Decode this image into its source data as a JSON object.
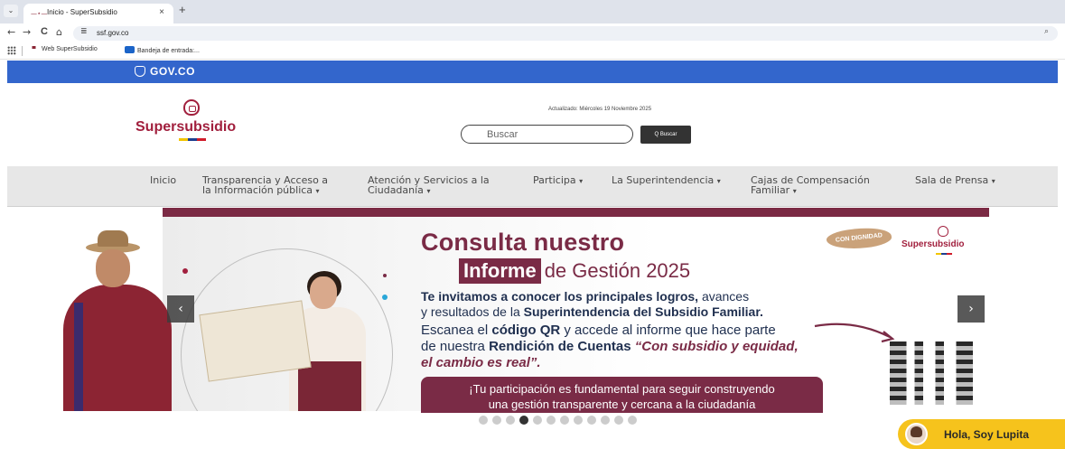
{
  "browser": {
    "tab_title": "Inicio - SuperSubsidio",
    "favicon": "—⋆—",
    "tab_close": "×",
    "new_tab": "+",
    "tab_menu": "⌄",
    "back": "←",
    "forward": "→",
    "reload": "C",
    "home": "⌂",
    "site_info": "≣",
    "url": "ssf.gov.co",
    "zoom": "⌕",
    "bookmarks": [
      "Web SuperSubsidio",
      "Bandeja de entrada:..."
    ]
  },
  "govbar": {
    "logo": "GOV.CO"
  },
  "header": {
    "brand": "Supersubsidio",
    "updated": "Actualizado: Miércoles 19 Noviembre 2025",
    "search_placeholder": "Buscar",
    "search_button": "Q Buscar"
  },
  "nav": {
    "items": [
      {
        "line1": "Inicio",
        "line2": ""
      },
      {
        "line1": "Transparencia y Acceso a",
        "line2": "la Información pública"
      },
      {
        "line1": "Atención y Servicios a la",
        "line2": "Ciudadanía"
      },
      {
        "line1": "Participa",
        "line2": ""
      },
      {
        "line1": "La Superintendencia",
        "line2": ""
      },
      {
        "line1": "Cajas de Compensación",
        "line2": "Familiar"
      },
      {
        "line1": "Sala de Prensa",
        "line2": ""
      }
    ],
    "caret": "▾"
  },
  "banner": {
    "headline_line1": "Consulta nuestro",
    "headline_chip": "Informe",
    "headline_rest": "de Gestión 2025",
    "p1_a": "Te invitamos a conocer los principales logros,",
    "p1_b": " avances",
    "p1_c": "y resultados de la ",
    "p1_d": "Superintendencia del Subsidio Familiar.",
    "p2_a": "Escanea el ",
    "p2_b": "código QR",
    "p2_c": " y accede al informe que hace parte",
    "p2_d": "de nuestra ",
    "p2_e": "Rendición de Cuentas ",
    "p2_f": "“Con subsidio y equidad,",
    "p2_g": "el cambio es real”.",
    "cta_line1": "¡Tu participación es fundamental para seguir construyendo",
    "cta_line2": "una gestión transparente y cercana a la ciudadanía",
    "badge": "CON DIGNIDAD",
    "brand": "Supersubsidio",
    "prev": "‹",
    "next": "›"
  },
  "carousel": {
    "slide_count": 12,
    "active_index": 3
  },
  "chat": {
    "label": "Hola, Soy Lupita"
  }
}
